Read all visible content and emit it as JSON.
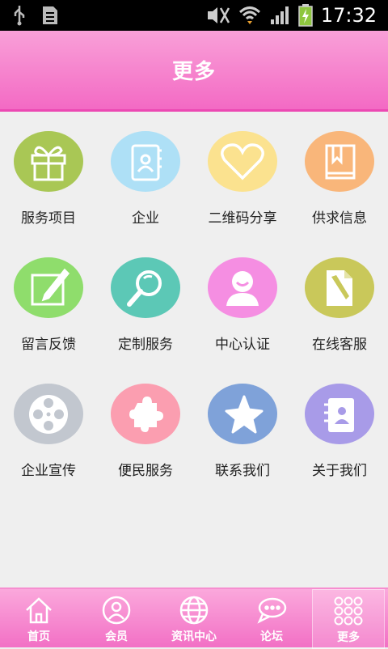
{
  "status": {
    "time": "17:32"
  },
  "header": {
    "title": "更多"
  },
  "grid": [
    {
      "label": "服务项目",
      "icon": "gift-icon",
      "color": "#a9c755"
    },
    {
      "label": "企业",
      "icon": "contact-book-icon",
      "color": "#aee0f6"
    },
    {
      "label": "二维码分享",
      "icon": "heart-icon",
      "color": "#fbe28f"
    },
    {
      "label": "供求信息",
      "icon": "book-icon",
      "color": "#f9b67a"
    },
    {
      "label": "留言反馈",
      "icon": "edit-icon",
      "color": "#8fdd6c"
    },
    {
      "label": "定制服务",
      "icon": "magnifier-icon",
      "color": "#5cc8b6"
    },
    {
      "label": "中心认证",
      "icon": "user-icon",
      "color": "#f58ee2"
    },
    {
      "label": "在线客服",
      "icon": "document-edit-icon",
      "color": "#c9c85a"
    },
    {
      "label": "企业宣传",
      "icon": "film-reel-icon",
      "color": "#c2c7cf"
    },
    {
      "label": "便民服务",
      "icon": "puzzle-icon",
      "color": "#fb9eb0"
    },
    {
      "label": "联系我们",
      "icon": "star-icon",
      "color": "#7fa2d9"
    },
    {
      "label": "关于我们",
      "icon": "address-book-icon",
      "color": "#a89be8"
    }
  ],
  "tabs": [
    {
      "label": "首页",
      "icon": "home-icon"
    },
    {
      "label": "会员",
      "icon": "member-icon"
    },
    {
      "label": "资讯中心",
      "icon": "globe-icon"
    },
    {
      "label": "论坛",
      "icon": "chat-icon"
    },
    {
      "label": "更多",
      "icon": "grid-dots-icon",
      "active": true
    }
  ]
}
